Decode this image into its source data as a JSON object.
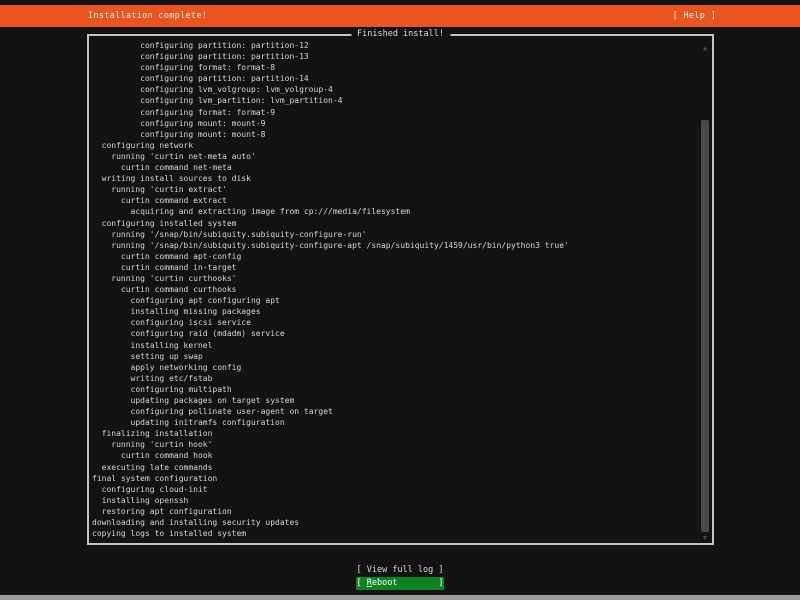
{
  "header": {
    "title": "Installation complete!",
    "help_label": "[ Help ]"
  },
  "panel": {
    "title": "Finished install!",
    "log_lines": [
      "          configuring partition: partition-12",
      "          configuring partition: partition-13",
      "          configuring format: format-8",
      "          configuring partition: partition-14",
      "          configuring lvm_volgroup: lvm_volgroup-4",
      "          configuring lvm_partition: lvm_partition-4",
      "          configuring format: format-9",
      "          configuring mount: mount-9",
      "          configuring mount: mount-8",
      "  configuring network",
      "    running 'curtin net-meta auto'",
      "      curtin command net-meta",
      "  writing install sources to disk",
      "    running 'curtin extract'",
      "      curtin command extract",
      "        acquiring and extracting image from cp:///media/filesystem",
      "  configuring installed system",
      "    running '/snap/bin/subiquity.subiquity-configure-run'",
      "    running '/snap/bin/subiquity.subiquity-configure-apt /snap/subiquity/1459/usr/bin/python3 true'",
      "      curtin command apt-config",
      "      curtin command in-target",
      "    running 'curtin curthooks'",
      "      curtin command curthooks",
      "        configuring apt configuring apt",
      "        installing missing packages",
      "        configuring iscsi service",
      "        configuring raid (mdadm) service",
      "        installing kernel",
      "        setting up swap",
      "        apply networking config",
      "        writing etc/fstab",
      "        configuring multipath",
      "        updating packages on target system",
      "        configuring pollinate user-agent on target",
      "        updating initramfs configuration",
      "  finalizing installation",
      "    running 'curtin hook'",
      "      curtin command hook",
      "  executing late commands",
      "final system configuration",
      "  configuring cloud-init",
      "  installing openssh",
      "  restoring apt configuration",
      "downloading and installing security updates",
      "copying logs to installed system"
    ]
  },
  "icons": {
    "scroll_up": "▲",
    "scroll_down": "▼"
  },
  "footer": {
    "view_log_label": "[ View full log ]",
    "reboot": {
      "prefix": "[ ",
      "accesskey": "R",
      "rest": "eboot",
      "suffix": "        ]"
    }
  },
  "colors": {
    "accent_orange": "#E9541F",
    "focus_green": "#0E8420",
    "background": "#131313",
    "border_gray": "#C4C4C4",
    "scrollbar_gray": "#4A4A4A"
  }
}
